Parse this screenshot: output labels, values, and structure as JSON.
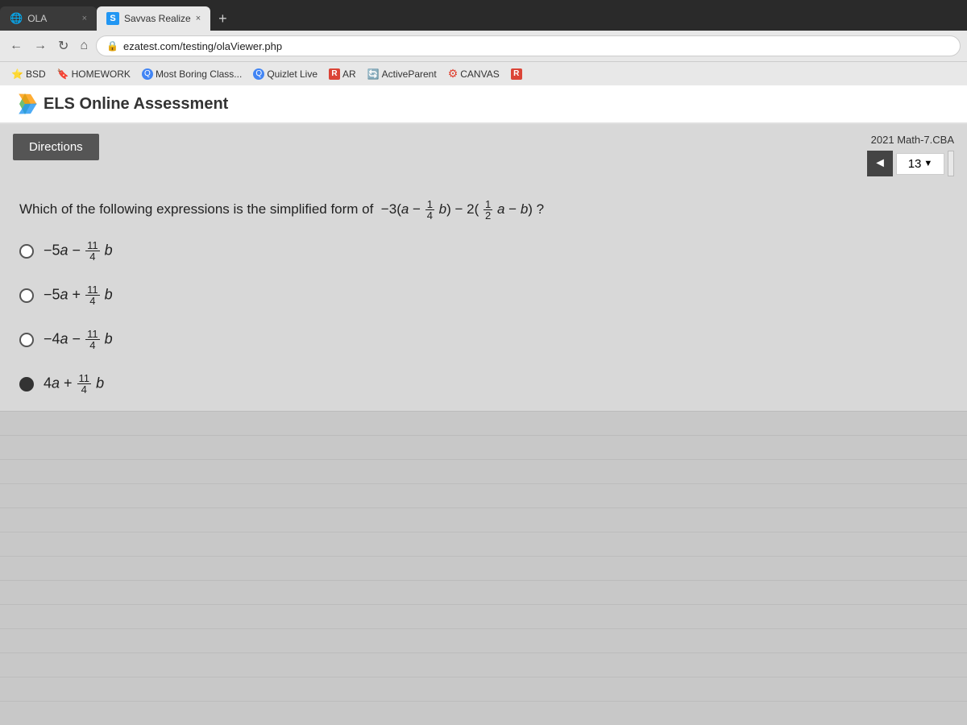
{
  "browser": {
    "tabs": [
      {
        "id": "ola",
        "label": "OLA",
        "icon": "🌐",
        "active": false
      },
      {
        "id": "savvas",
        "label": "Savvas Realize",
        "icon": "S",
        "active": true
      }
    ],
    "tab_new_label": "+",
    "nav": {
      "back_label": "←",
      "forward_label": "→",
      "reload_label": "↻",
      "home_label": "⌂"
    },
    "address": "ezatest.com/testing/olaViewer.php",
    "lock_icon": "🔒",
    "close_label": "×"
  },
  "bookmarks": [
    {
      "id": "bsd",
      "label": "BSD",
      "icon": "⭐"
    },
    {
      "id": "homework",
      "label": "HOMEWORK",
      "icon": "🔖"
    },
    {
      "id": "most-boring",
      "label": "Most Boring Class...",
      "icon": "🔍"
    },
    {
      "id": "quizlet-live",
      "label": "Quizlet Live",
      "icon": "🔍"
    },
    {
      "id": "ar",
      "label": "AR",
      "icon": "R"
    },
    {
      "id": "activeparent",
      "label": "ActiveParent",
      "icon": "🔄"
    },
    {
      "id": "canvas",
      "label": "CANVAS",
      "icon": "⚙"
    },
    {
      "id": "r2",
      "label": "R",
      "icon": "R"
    }
  ],
  "page": {
    "app_name": "ELS Online Assessment",
    "assessment_name": "2021 Math-7.CBA",
    "directions_label": "Directions",
    "question_number": "13",
    "nav_prev_label": "◄",
    "dropdown_arrow": "▼",
    "question_text": "Which of the following expressions is the simplified form of",
    "options": [
      {
        "id": "A",
        "text_html": "−5a − 11/4 b",
        "selected": false
      },
      {
        "id": "B",
        "text_html": "−5a + 11/4 b",
        "selected": false
      },
      {
        "id": "C",
        "text_html": "−4a − 11/4 b",
        "selected": false
      },
      {
        "id": "D",
        "text_html": "4a + 11/4 b",
        "selected": true
      }
    ]
  }
}
